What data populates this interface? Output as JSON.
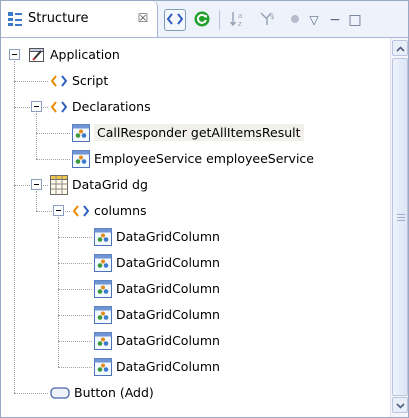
{
  "view": {
    "tab_label": "Structure",
    "tab_icon": "structure-outline-icon",
    "close_glyph": "☒"
  },
  "toolbar": {
    "buttons": [
      {
        "name": "toggle-source-view-button",
        "icon": "angle-brackets-icon",
        "pressed": true
      },
      {
        "name": "refresh-button",
        "icon": "refresh-green-icon",
        "pressed": false
      },
      {
        "name": "sort-alphabetically-button",
        "icon": "sort-az-icon",
        "pressed": false
      },
      {
        "name": "hide-non-public-button",
        "icon": "filter-dollar-icon",
        "pressed": false
      },
      {
        "name": "hide-fields-button",
        "icon": "dot-icon",
        "pressed": false
      }
    ],
    "menu_glyph": "▽",
    "minimize_glyph": "−",
    "maximize_glyph": "□"
  },
  "tree": {
    "nodes": [
      {
        "label": "Application",
        "icon": "application-icon",
        "expanded": true,
        "level": 0
      },
      {
        "label": "Script",
        "icon": "tag-brackets-icon",
        "level": 1
      },
      {
        "label": "Declarations",
        "icon": "tag-brackets-icon",
        "expanded": true,
        "level": 1
      },
      {
        "label": "CallResponder getAllItemsResult",
        "icon": "component-icon",
        "level": 2,
        "selected": true
      },
      {
        "label": "EmployeeService employeeService",
        "icon": "component-icon",
        "level": 2
      },
      {
        "label": "DataGrid dg",
        "icon": "datagrid-icon",
        "expanded": true,
        "level": 1
      },
      {
        "label": "columns",
        "icon": "tag-brackets-icon",
        "expanded": true,
        "level": 2
      },
      {
        "label": "DataGridColumn",
        "icon": "component-icon",
        "level": 3
      },
      {
        "label": "DataGridColumn",
        "icon": "component-icon",
        "level": 3
      },
      {
        "label": "DataGridColumn",
        "icon": "component-icon",
        "level": 3
      },
      {
        "label": "DataGridColumn",
        "icon": "component-icon",
        "level": 3
      },
      {
        "label": "DataGridColumn",
        "icon": "component-icon",
        "level": 3
      },
      {
        "label": "DataGridColumn",
        "icon": "component-icon",
        "level": 3
      },
      {
        "label": "Button (Add)",
        "icon": "button-icon",
        "level": 1
      }
    ]
  },
  "colors": {
    "accent_green": "#21a02b",
    "bracket_orange": "#e68a00",
    "bracket_blue": "#2f5fbf",
    "selection": "#f2f1ee"
  }
}
